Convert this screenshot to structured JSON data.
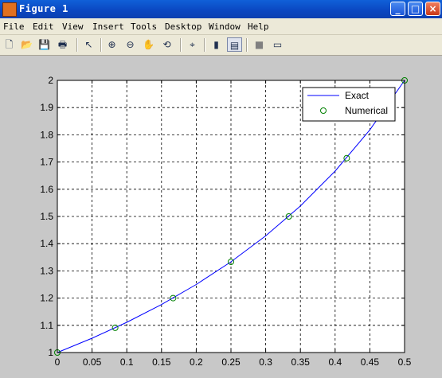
{
  "window": {
    "title": "Figure 1"
  },
  "title_buttons": {
    "minimize": "_",
    "maximize": "□",
    "close": "×"
  },
  "menu": [
    "File",
    "Edit",
    "View",
    "Insert",
    "Tools",
    "Desktop",
    "Window",
    "Help"
  ],
  "toolbar": {
    "tools": [
      "new-figure",
      "open-file",
      "save",
      "print",
      "edit-plot",
      "zoom-in",
      "zoom-out",
      "pan",
      "rotate-3d",
      "data-cursor",
      "insert-colorbar",
      "insert-legend",
      "hide-plot-tools",
      "show-plot-tools"
    ],
    "glyphs": {
      "new-figure": "🗋",
      "open-file": "📂",
      "save": "💾",
      "print": "🖶",
      "edit-plot": "↖",
      "zoom-in": "⊕",
      "zoom-out": "⊖",
      "pan": "✋",
      "rotate-3d": "⟲",
      "data-cursor": "⌖",
      "insert-colorbar": "▮",
      "insert-legend": "▤",
      "hide-plot-tools": "■",
      "show-plot-tools": "▭"
    }
  },
  "chart_data": {
    "type": "line",
    "title": "",
    "xlabel": "",
    "ylabel": "",
    "xlim": [
      0,
      0.5
    ],
    "ylim": [
      1,
      2
    ],
    "grid": true,
    "legend_position": "top-right",
    "x_ticks": [
      "0",
      "0.05",
      "0.1",
      "0.15",
      "0.2",
      "0.25",
      "0.3",
      "0.35",
      "0.4",
      "0.45",
      "0.5"
    ],
    "y_ticks": [
      "1",
      "1.1",
      "1.2",
      "1.3",
      "1.4",
      "1.5",
      "1.6",
      "1.7",
      "1.8",
      "1.9",
      "2"
    ],
    "series": [
      {
        "name": "Exact",
        "style": "line",
        "color": "#0000ff",
        "x": [
          0,
          0.05,
          0.1,
          0.15,
          0.2,
          0.25,
          0.3,
          0.35,
          0.4,
          0.45,
          0.5
        ],
        "y": [
          1,
          1.0526,
          1.1111,
          1.1765,
          1.25,
          1.3333,
          1.4286,
          1.5385,
          1.6667,
          1.8182,
          2
        ]
      },
      {
        "name": "Numerical",
        "style": "markers",
        "marker": "circle",
        "color": "#008000",
        "x": [
          0,
          0.0833,
          0.1667,
          0.25,
          0.3333,
          0.4167,
          0.5
        ],
        "y": [
          1,
          1.0909,
          1.2,
          1.3333,
          1.5,
          1.7143,
          2
        ]
      }
    ]
  }
}
